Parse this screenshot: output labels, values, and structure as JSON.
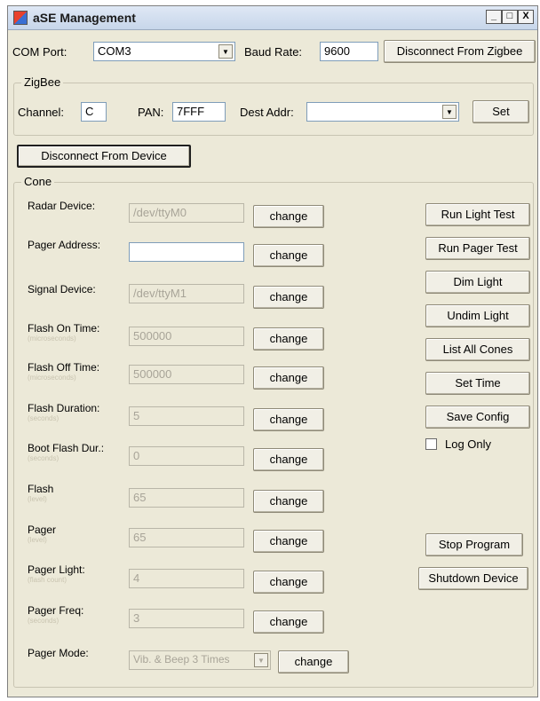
{
  "window": {
    "title": "aSE Management",
    "min_label": "_",
    "max_label": "□",
    "close_label": "X"
  },
  "top": {
    "com_port_label": "COM Port:",
    "com_port_value": "COM3",
    "baud_rate_label": "Baud Rate:",
    "baud_rate_value": "9600",
    "disconnect_zigbee_label": "Disconnect From Zigbee"
  },
  "zigbee": {
    "group_label": "ZigBee",
    "channel_label": "Channel:",
    "channel_value": "C",
    "pan_label": "PAN:",
    "pan_value": "7FFF",
    "dest_addr_label": "Dest Addr:",
    "dest_addr_value": "",
    "set_label": "Set"
  },
  "device": {
    "disconnect_device_label": "Disconnect From Device"
  },
  "cone": {
    "group_label": "Cone",
    "change_label": "change",
    "fields": [
      {
        "label": "Radar Device:",
        "value": "/dev/ttyM0",
        "sub": ""
      },
      {
        "label": "Pager Address:",
        "value": "",
        "sub": ""
      },
      {
        "label": "Signal Device:",
        "value": "/dev/ttyM1",
        "sub": ""
      },
      {
        "label": "Flash On Time:",
        "value": "500000",
        "sub": "(microseconds)"
      },
      {
        "label": "Flash Off Time:",
        "value": "500000",
        "sub": "(microseconds)"
      },
      {
        "label": "Flash Duration:",
        "value": "5",
        "sub": "(seconds)"
      },
      {
        "label": "Boot Flash Dur.:",
        "value": "0",
        "sub": "(seconds)"
      },
      {
        "label": "Flash",
        "value": "65",
        "sub": "(level)"
      },
      {
        "label": "Pager",
        "value": "65",
        "sub": "(level)"
      },
      {
        "label": "Pager Light:",
        "value": "4",
        "sub": "(flash count)"
      },
      {
        "label": "Pager Freq:",
        "value": "3",
        "sub": "(seconds)"
      },
      {
        "label": "Pager Mode:",
        "value": "Vib. & Beep 3 Times",
        "sub": ""
      }
    ],
    "actions": {
      "run_light_test": "Run Light Test",
      "run_pager_test": "Run Pager Test",
      "dim_light": "Dim Light",
      "undim_light": "Undim Light",
      "list_all_cones": "List All Cones",
      "set_time": "Set Time",
      "save_config": "Save Config",
      "log_only": "Log Only",
      "stop_program": "Stop Program",
      "shutdown_device": "Shutdown Device"
    }
  }
}
